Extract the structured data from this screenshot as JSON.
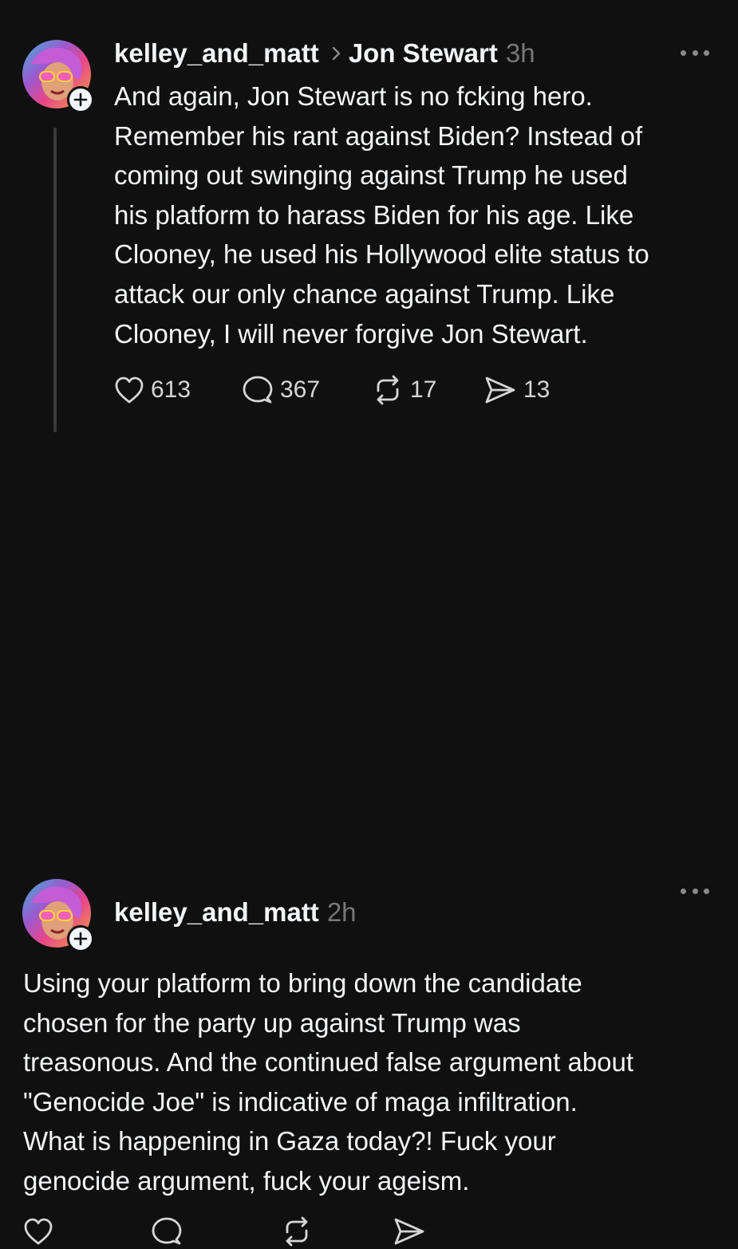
{
  "posts": [
    {
      "author": "kelley_and_matt",
      "reply_to": "Jon Stewart",
      "time": "3h",
      "text": "And again, Jon Stewart is no fcking hero.\nRemember his rant against Biden? Instead of\ncoming out swinging against Trump he used\nhis platform to harass Biden for his age. Like\nClooney, he used his Hollywood elite status to\nattack our only chance against Trump. Like\nClooney, I will never forgive Jon Stewart.",
      "likes": "613",
      "replies": "367",
      "reposts": "17",
      "shares": "13"
    },
    {
      "author": "kelley_and_matt",
      "time": "2h",
      "text": "Using your platform to bring down the candidate\nchosen for the party up against Trump was\ntreasonous. And the continued false argument about\n\"Genocide Joe\" is indicative of maga infiltration.\nWhat is happening in Gaza today?! Fuck your\ngenocide argument, fuck your ageism."
    }
  ],
  "icons": {
    "like": "heart-icon",
    "reply": "speech-bubble-icon",
    "repost": "repost-arrows-icon",
    "share": "send-icon",
    "more": "more-dots-icon",
    "follow": "plus-icon",
    "separator": "chevron-right-icon"
  },
  "colors": {
    "background": "#101010",
    "text": "#f3f5f7",
    "muted": "#777777"
  }
}
